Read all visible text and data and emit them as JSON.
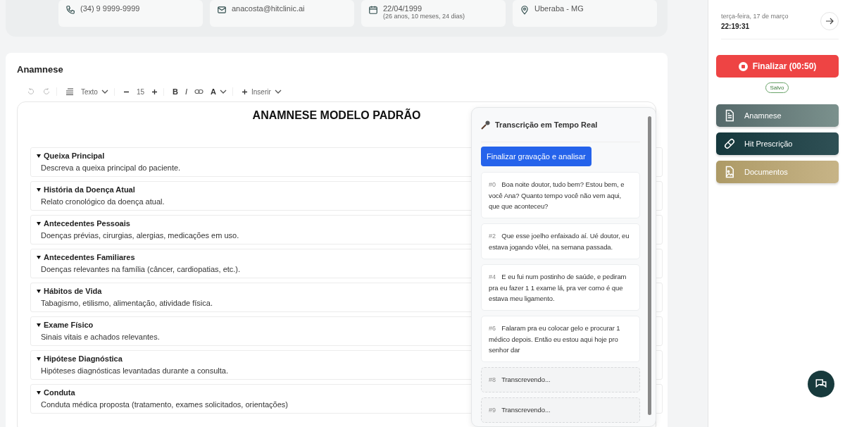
{
  "patient_info": [
    {
      "kind": "phone",
      "text": "(34) 9 9999-9999"
    },
    {
      "kind": "email",
      "text": "anacosta@hitclinic.ai"
    },
    {
      "kind": "birth",
      "text": "22/04/1999",
      "sub": "(26 anos, 10 meses, 24 dias)"
    },
    {
      "kind": "location",
      "text": "Uberaba - MG"
    }
  ],
  "anamnese": {
    "title": "Anamnese",
    "toolbar": {
      "style": "Texto",
      "font_size": "15",
      "bold": "B",
      "italic": "I",
      "text_color_label": "A",
      "insert": "Inserir"
    },
    "document_title": "ANAMNESE MODELO PADRÃO",
    "sections": [
      {
        "title": "Queixa Principal",
        "text": "Descreva a queixa principal do paciente.",
        "expanded": true
      },
      {
        "title": "História da Doença Atual",
        "text": "Relato cronológico da doença atual.",
        "expanded": true
      },
      {
        "title": "Antecedentes Pessoais",
        "text": "Doenças prévias, cirurgias, alergias, medicações em uso.",
        "expanded": true
      },
      {
        "title": "Antecedentes Familiares",
        "text": "Doenças relevantes na família (câncer, cardiopatias, etc.).",
        "expanded": true
      },
      {
        "title": "Hábitos de Vida",
        "text": "Tabagismo, etilismo, alimentação, atividade física.",
        "expanded": true
      },
      {
        "title": "Exame Físico",
        "text": "Sinais vitais e achados relevantes.",
        "expanded": true
      },
      {
        "title": "Hipótese Diagnóstica",
        "text": "Hipóteses diagnósticas levantadas durante a consulta.",
        "expanded": true
      },
      {
        "title": "Conduta",
        "text": "Conduta médica proposta (tratamento, exames solicitados, orientações)",
        "expanded": true
      }
    ]
  },
  "transcription": {
    "title": "Transcrição em Tempo Real",
    "button": "Finalizar gravação e analisar",
    "entries": [
      {
        "kind": "text",
        "index": "#0",
        "text": "Boa noite doutor, tudo bem? Estou bem, e você Ana? Quanto tempo você não vem aqui, que que aconteceu?"
      },
      {
        "kind": "text",
        "index": "#2",
        "text": "Que esse joelho enfaixado aí. Ué doutor, eu estava jogando vôlei, na semana passada."
      },
      {
        "kind": "text",
        "index": "#4",
        "text": "E eu fui num postinho de saúde, e pediram pra eu fazer 1 1 exame lá, pra ver como é que estava meu ligamento."
      },
      {
        "kind": "text",
        "index": "#6",
        "text": "Falaram pra eu colocar gelo e procurar 1 médico depois. Então eu estou aqui hoje pro senhor dar"
      },
      {
        "kind": "pending",
        "index": "#8",
        "text": "Transcrevendo..."
      },
      {
        "kind": "pending",
        "index": "#9",
        "text": "Transcrevendo..."
      }
    ]
  },
  "sidebar": {
    "date": "terça-feira, 17 de março",
    "time": "22:19:31",
    "finish_button": "Finalizar (00:50)",
    "status": "Salvo",
    "nav": [
      {
        "kind": "anamnese",
        "label": "Anamnese"
      },
      {
        "kind": "prescription",
        "label": "Hit Prescrição"
      },
      {
        "kind": "documents",
        "label": "Documentos"
      }
    ]
  }
}
